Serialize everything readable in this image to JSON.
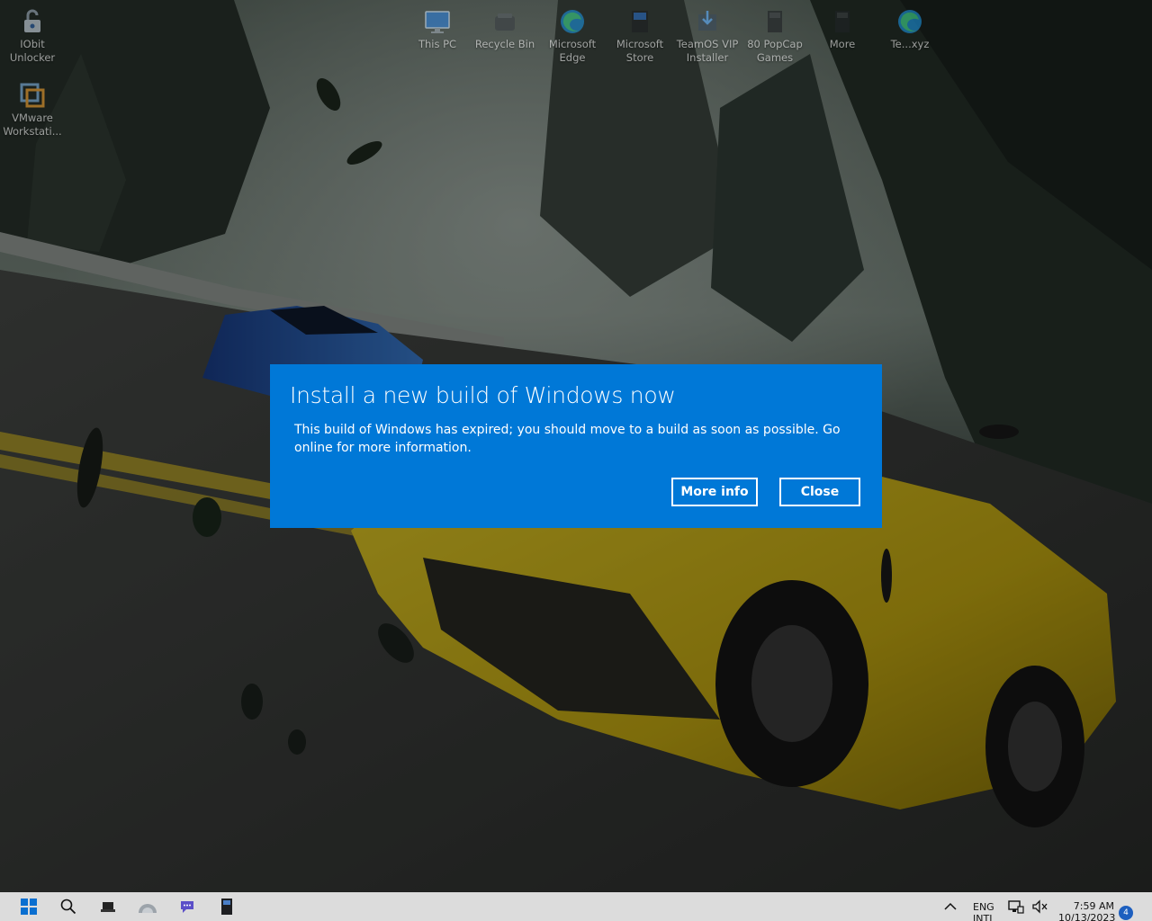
{
  "desktop": {
    "left_icons": [
      {
        "label": "IObit Unlocker",
        "icon": "lock-icon"
      },
      {
        "label": "VMware Workstati...",
        "icon": "vmware-icon"
      }
    ],
    "top_icons": [
      {
        "label": "This PC",
        "icon": "monitor-icon"
      },
      {
        "label": "Recycle Bin",
        "icon": "recycle-bin-icon"
      },
      {
        "label": "Microsoft Edge",
        "icon": "edge-icon"
      },
      {
        "label": "Microsoft Store",
        "icon": "store-icon"
      },
      {
        "label": "TeamOS VIP Installer",
        "icon": "installer-icon"
      },
      {
        "label": "80 PopCap Games",
        "icon": "popcap-icon"
      },
      {
        "label": "More",
        "icon": "more-app-icon"
      },
      {
        "label": "Te...xyz",
        "icon": "edge-shortcut-icon"
      }
    ]
  },
  "dialog": {
    "title": "Install a new build of Windows now",
    "body": "This build of Windows has expired; you should move to a build as soon as possible. Go online for more information.",
    "more_info_label": "More info",
    "close_label": "Close",
    "background_color": "#0078d7"
  },
  "taskbar": {
    "items": [
      {
        "icon": "windows-start-icon"
      },
      {
        "icon": "search-icon"
      },
      {
        "icon": "file-explorer-icon"
      },
      {
        "icon": "cloud-app-icon"
      },
      {
        "icon": "chat-app-icon"
      },
      {
        "icon": "store-app-icon"
      }
    ],
    "tray": {
      "language_line1": "ENG",
      "language_line2": "INTL",
      "time": "7:59 AM",
      "date": "10/13/2023",
      "notification_count": "4"
    },
    "background_color": "#dcdcdc"
  }
}
